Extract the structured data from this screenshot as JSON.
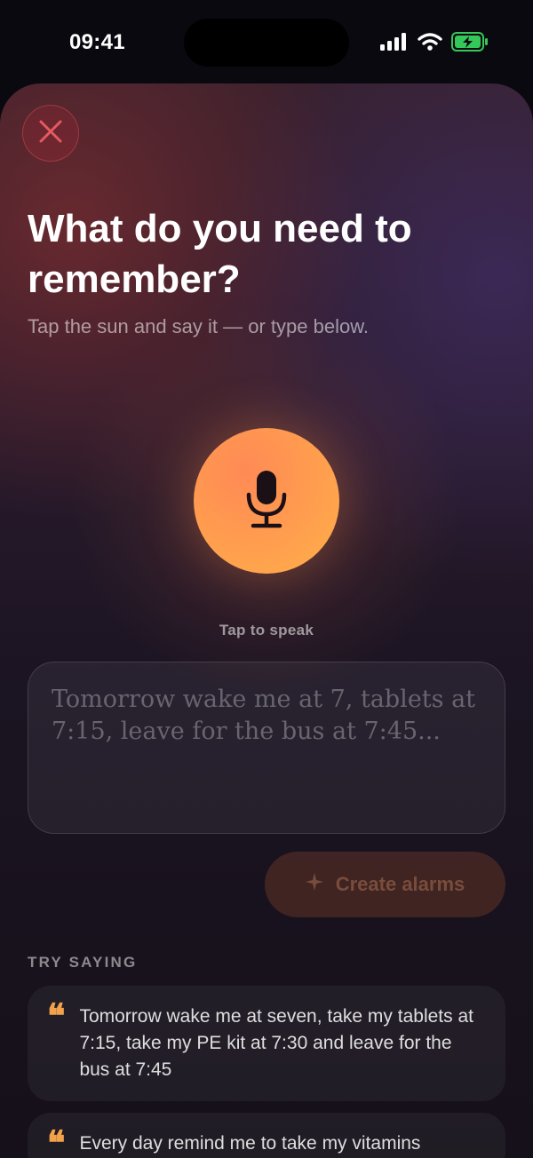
{
  "status_bar": {
    "time": "09:41",
    "icons": [
      "signal-icon",
      "wifi-icon",
      "battery-charging-icon"
    ],
    "battery_color": "#34c759"
  },
  "sheet": {
    "close_icon": "close-icon",
    "title": "What do you need to remember?",
    "subtitle": "Tap the sun and say it — or type below.",
    "mic_icon": "microphone-icon",
    "tap_label": "Tap to speak",
    "input": {
      "value": "",
      "placeholder": "Tomorrow wake me at 7, tablets at 7:15, leave for the bus at 7:45..."
    },
    "create_button": {
      "icon": "sparkle-icon",
      "label": "Create alarms"
    },
    "try_saying": {
      "label": "TRY SAYING",
      "examples": [
        "Tomorrow wake me at seven, take my tablets at 7:15, take my PE kit at 7:30 and leave for the bus at 7:45",
        "Every day remind me to take my vitamins"
      ]
    },
    "colors": {
      "accent": "#ff9a4f",
      "close": "#e55a5f",
      "quote": "#f2a24a"
    }
  }
}
